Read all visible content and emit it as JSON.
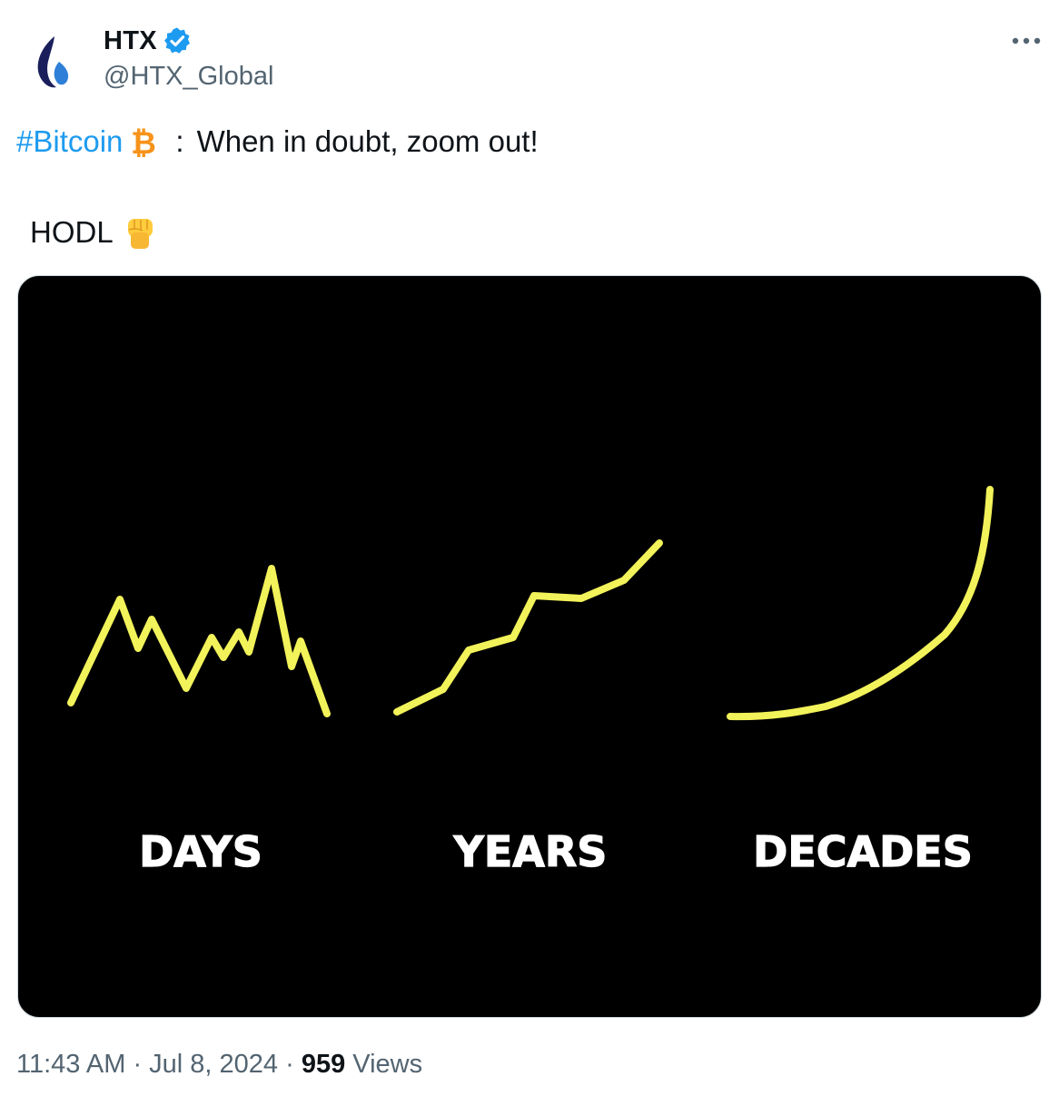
{
  "author": {
    "name": "HTX",
    "handle": "@HTX_Global",
    "avatar_icon": "htx-flame-logo",
    "verified_icon": "verified-badge-icon",
    "colors": {
      "verified": "#1d9bf0",
      "logo": "#1a1f5c",
      "logo_accent": "#2e7fd8"
    }
  },
  "menu": {
    "icon": "more-horizontal-icon",
    "glyph": "•••"
  },
  "tweet": {
    "hashtag": "#Bitcoin",
    "hashtag_icon": "bitcoin-icon",
    "separator": ":",
    "text": "When in doubt, zoom out!",
    "line2": "HODL",
    "line2_icon": "raised-fist-emoji",
    "colors": {
      "hashtag": "#1d9bf0",
      "bitcoin": "#f7931a"
    }
  },
  "media": {
    "background": "#000000",
    "line_color": "#f2f25a",
    "label_color": "#ffffff",
    "panels": [
      {
        "label": "DAYS"
      },
      {
        "label": "YEARS"
      },
      {
        "label": "DECADES"
      }
    ]
  },
  "meta": {
    "time": "11:43 AM",
    "dot1": " · ",
    "date": "Jul 8, 2024",
    "dot2": " · ",
    "views_count": "959",
    "views_label": " Views"
  }
}
